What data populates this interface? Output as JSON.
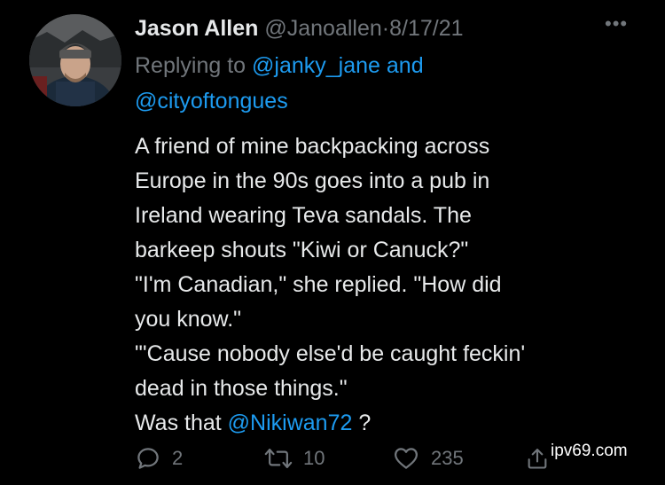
{
  "tweet": {
    "author_name": "Jason Allen",
    "author_handle": "@Janoallen",
    "separator": "·",
    "date": "8/17/21",
    "more_label": "•••",
    "replying_prefix": "Replying to ",
    "replying_to": [
      "@janky_jane",
      "@cityoftongues"
    ],
    "replying_joiner": " and",
    "body_lines": [
      "A friend of mine backpacking across",
      "Europe in the 90s goes into a pub in",
      "Ireland wearing Teva sandals. The",
      "barkeep shouts \"Kiwi or Canuck?\"",
      "\"I'm Canadian,\" she replied. \"How did",
      "you know.\"",
      "\"'Cause nobody else'd be caught feckin'",
      "dead in those things.\""
    ],
    "last_line_prefix": "Was that ",
    "last_line_mention": "@Nikiwan72",
    "last_line_suffix": " ?"
  },
  "actions": {
    "reply": {
      "icon": "reply-icon",
      "count": "2"
    },
    "retweet": {
      "icon": "retweet-icon",
      "count": "10"
    },
    "like": {
      "icon": "heart-icon",
      "count": "235"
    },
    "share": {
      "icon": "share-icon"
    }
  },
  "watermark": "ipv69.com",
  "colors": {
    "background": "#000000",
    "text": "#e7e9ea",
    "muted": "#71767b",
    "link": "#1d9bf0"
  }
}
